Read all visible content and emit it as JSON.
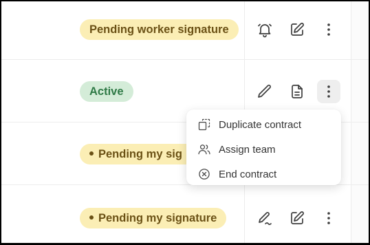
{
  "rows": [
    {
      "status": "Pending worker signature",
      "status_color": "#fbeeb5",
      "has_dot": false,
      "icons": [
        "bell-icon",
        "edit-icon",
        "more-vertical-icon"
      ]
    },
    {
      "status": "Active",
      "status_color": "#d4ecd8",
      "has_dot": false,
      "icons": [
        "pencil-icon",
        "document-icon",
        "more-vertical-icon"
      ]
    },
    {
      "status": "Pending my sig",
      "status_color": "#fbeeb5",
      "has_dot": true,
      "icons": []
    },
    {
      "status": "Pending my signature",
      "status_color": "#fbeeb5",
      "has_dot": true,
      "icons": [
        "signature-icon",
        "edit-icon",
        "more-vertical-icon"
      ]
    }
  ],
  "menu": {
    "items": [
      {
        "label": "Duplicate contract",
        "icon": "duplicate-icon"
      },
      {
        "label": "Assign team",
        "icon": "team-icon"
      },
      {
        "label": "End contract",
        "icon": "close-circle-icon"
      }
    ]
  }
}
